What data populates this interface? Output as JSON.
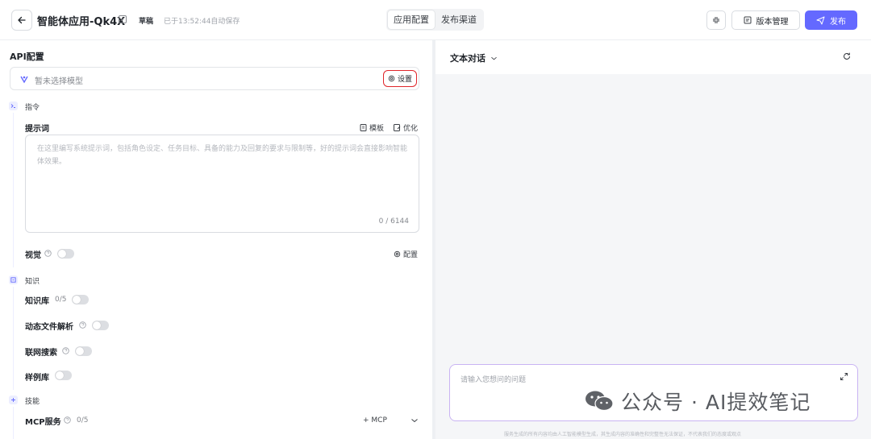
{
  "header": {
    "app_title": "智能体应用-Qk4X",
    "draft_label": "草稿",
    "save_status": "已于13:52:44自动保存",
    "tabs": [
      {
        "label": "应用配置",
        "active": true
      },
      {
        "label": "发布渠道",
        "active": false
      }
    ],
    "version_label": "版本管理",
    "publish_label": "发布"
  },
  "api_config": {
    "title": "API配置",
    "model_placeholder": "暂未选择模型",
    "settings_label": "设置"
  },
  "instructions": {
    "group_label": "指令",
    "prompt_label": "提示词",
    "template_label": "模板",
    "optimize_label": "优化",
    "prompt_placeholder": "在这里编写系统提示词，包括角色设定、任务目标、具备的能力及回复的要求与限制等，好的提示词会直接影响智能体效果。",
    "char_count": "0 / 6144",
    "vision_label": "视觉",
    "vision_config_label": "配置",
    "vision_enabled": false
  },
  "knowledge": {
    "group_label": "知识",
    "kb_label": "知识库",
    "kb_count": "0/5",
    "file_parse_label": "动态文件解析",
    "web_search_label": "联网搜索",
    "examples_label": "样例库"
  },
  "skills": {
    "group_label": "技能",
    "mcp_label": "MCP服务",
    "mcp_count": "0/5",
    "add_mcp_label": "+ MCP"
  },
  "chat": {
    "mode_label": "文本对话",
    "input_placeholder": "请输入您想问的问题",
    "disclaimer": "服务生成的所有内容均由人工智能模型生成，其生成内容的准确性和完整性无法保证，不代表我们的态度或观点"
  },
  "watermark": {
    "text": "公众号 · AI提效笔记"
  },
  "colors": {
    "accent": "#6469ff",
    "highlight_border": "#e0262b",
    "chat_border": "#c9b4f3"
  }
}
